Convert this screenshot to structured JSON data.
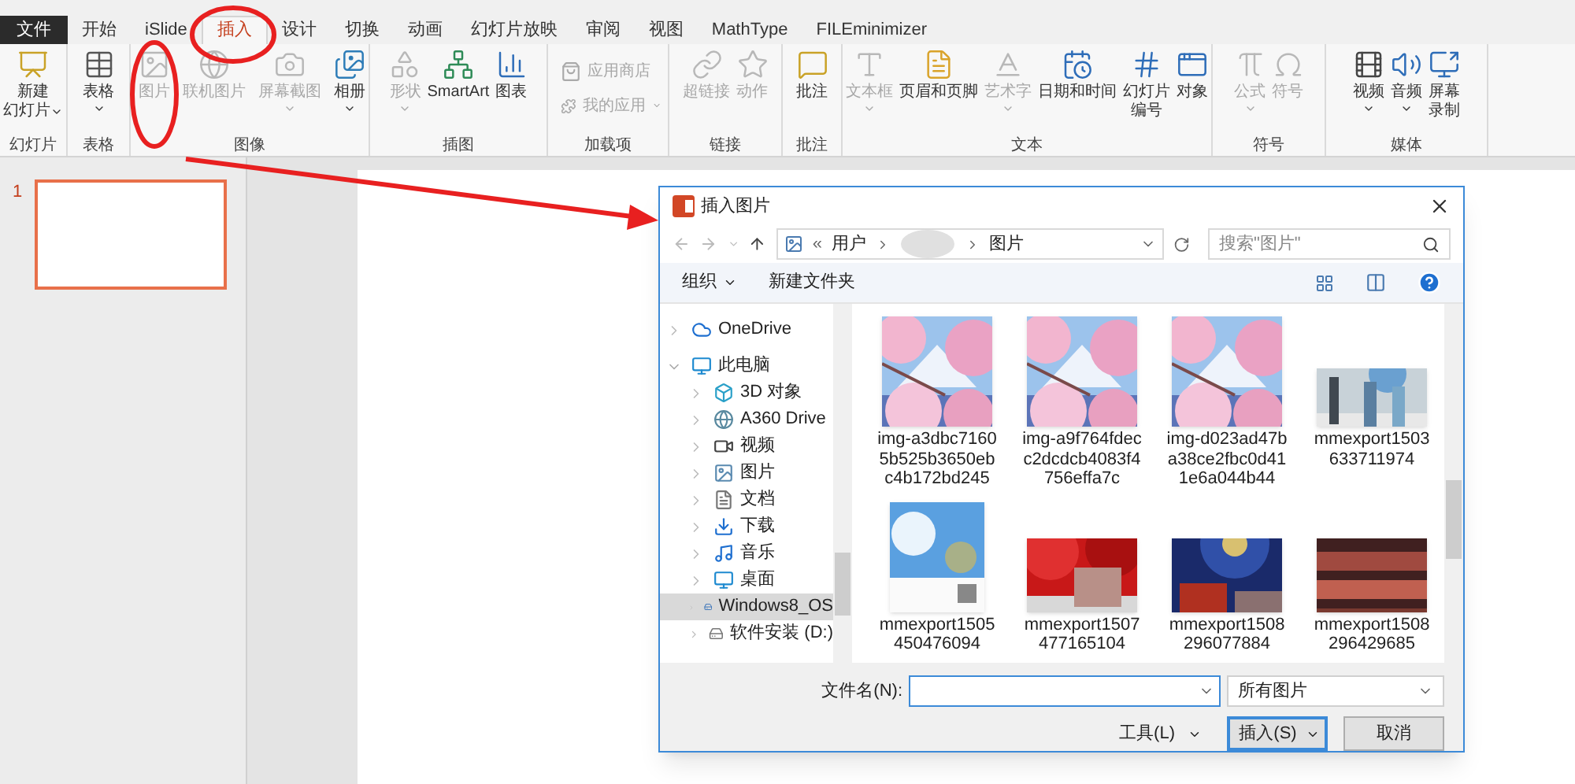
{
  "tabs": [
    {
      "label": "文件",
      "kind": "file",
      "selected": false
    },
    {
      "label": "开始",
      "kind": "tab",
      "selected": false
    },
    {
      "label": "iSlide",
      "kind": "tab",
      "selected": false
    },
    {
      "label": "插入",
      "kind": "tab",
      "selected": true
    },
    {
      "label": "设计",
      "kind": "tab",
      "selected": false
    },
    {
      "label": "切换",
      "kind": "tab",
      "selected": false
    },
    {
      "label": "动画",
      "kind": "tab",
      "selected": false
    },
    {
      "label": "幻灯片放映",
      "kind": "tab",
      "selected": false
    },
    {
      "label": "审阅",
      "kind": "tab",
      "selected": false
    },
    {
      "label": "视图",
      "kind": "tab",
      "selected": false
    },
    {
      "label": "MathType",
      "kind": "tab",
      "selected": false
    },
    {
      "label": "FILEminimizer",
      "kind": "tab",
      "selected": false
    }
  ],
  "ribbon": {
    "groups": [
      {
        "label": "幻灯片",
        "buttons": [
          {
            "lines": [
              "新建",
              "幻灯片"
            ],
            "kind": "large",
            "disabled": false,
            "dropdown": true
          }
        ]
      },
      {
        "label": "表格",
        "buttons": [
          {
            "label": "表格",
            "kind": "large",
            "disabled": false,
            "dropdown": true
          }
        ]
      },
      {
        "label": "图像",
        "buttons": [
          {
            "label": "图片",
            "kind": "large",
            "disabled": true,
            "dropdown": false
          },
          {
            "label": "联机图片",
            "kind": "large",
            "disabled": true,
            "dropdown": false
          },
          {
            "label": "屏幕截图",
            "kind": "large",
            "disabled": true,
            "dropdown": true
          },
          {
            "label": "相册",
            "kind": "large",
            "disabled": false,
            "dropdown": true
          }
        ]
      },
      {
        "label": "插图",
        "buttons": [
          {
            "label": "形状",
            "kind": "large",
            "disabled": true,
            "dropdown": true
          },
          {
            "label": "SmartArt",
            "kind": "large",
            "disabled": false,
            "dropdown": false
          },
          {
            "label": "图表",
            "kind": "large",
            "disabled": false,
            "dropdown": false
          }
        ]
      },
      {
        "label": "加载项",
        "buttons": [
          {
            "label": "应用商店",
            "kind": "small",
            "disabled": true,
            "dropdown": false
          },
          {
            "label": "我的应用",
            "kind": "small",
            "disabled": true,
            "dropdown": true
          }
        ]
      },
      {
        "label": "链接",
        "buttons": [
          {
            "label": "超链接",
            "kind": "large",
            "disabled": true,
            "dropdown": false
          },
          {
            "label": "动作",
            "kind": "large",
            "disabled": true,
            "dropdown": false
          }
        ]
      },
      {
        "label": "批注",
        "buttons": [
          {
            "label": "批注",
            "kind": "large",
            "disabled": false,
            "dropdown": false
          }
        ]
      },
      {
        "label": "文本",
        "buttons": [
          {
            "label": "文本框",
            "kind": "large",
            "disabled": true,
            "dropdown": true
          },
          {
            "label": "页眉和页脚",
            "kind": "large",
            "disabled": false,
            "dropdown": false
          },
          {
            "label": "艺术字",
            "kind": "large",
            "disabled": true,
            "dropdown": true
          },
          {
            "label": "日期和时间",
            "kind": "large",
            "disabled": false,
            "dropdown": false
          },
          {
            "lines": [
              "幻灯片",
              "编号"
            ],
            "kind": "large",
            "disabled": false,
            "dropdown": false
          },
          {
            "label": "对象",
            "kind": "large",
            "disabled": false,
            "dropdown": false
          }
        ]
      },
      {
        "label": "符号",
        "buttons": [
          {
            "label": "公式",
            "kind": "large",
            "disabled": true,
            "dropdown": true
          },
          {
            "label": "符号",
            "kind": "large",
            "disabled": true,
            "dropdown": false
          }
        ]
      },
      {
        "label": "媒体",
        "buttons": [
          {
            "label": "视频",
            "kind": "large",
            "disabled": false,
            "dropdown": true
          },
          {
            "label": "音频",
            "kind": "large",
            "disabled": false,
            "dropdown": true
          },
          {
            "lines": [
              "屏幕",
              "录制"
            ],
            "kind": "large",
            "disabled": false,
            "dropdown": false
          }
        ]
      }
    ]
  },
  "slides": [
    {
      "number": "1",
      "selected": true
    }
  ],
  "dialog": {
    "title": "插入图片",
    "address": {
      "overflow": "«",
      "segments": [
        "用户",
        "图片"
      ]
    },
    "search": {
      "placeholder": "搜索\"图片\""
    },
    "toolbar": [
      "组织",
      "新建文件夹"
    ],
    "tree": [
      {
        "label": "OneDrive",
        "expanded": false,
        "selected": false
      },
      {
        "label": "此电脑",
        "expanded": true,
        "selected": false,
        "children": [
          {
            "label": "3D 对象",
            "expanded": false,
            "selected": false
          },
          {
            "label": "A360 Drive",
            "expanded": false,
            "selected": false
          },
          {
            "label": "视频",
            "expanded": false,
            "selected": false
          },
          {
            "label": "图片",
            "expanded": false,
            "selected": false
          },
          {
            "label": "文档",
            "expanded": false,
            "selected": false
          },
          {
            "label": "下载",
            "expanded": false,
            "selected": false
          },
          {
            "label": "音乐",
            "expanded": false,
            "selected": false
          },
          {
            "label": "桌面",
            "expanded": false,
            "selected": false
          },
          {
            "label": "Windows8_OS",
            "expanded": false,
            "selected": true
          },
          {
            "label": "软件安装 (D:)",
            "expanded": false,
            "selected": false
          }
        ]
      }
    ],
    "files": [
      {
        "name": "img-a3dbc71605b525b3650ebc4b172bd245",
        "kind": "picture"
      },
      {
        "name": "img-a9f764fdecc2dcdcb4083f4756effa7c",
        "kind": "picture"
      },
      {
        "name": "img-d023ad47ba38ce2fbc0d411e6a044b44",
        "kind": "picture"
      },
      {
        "name": "mmexport1503633711974",
        "kind": "picture"
      },
      {
        "name": "mmexport1505450476094",
        "kind": "picture"
      },
      {
        "name": "mmexport1507477165104",
        "kind": "picture"
      },
      {
        "name": "mmexport1508296077884",
        "kind": "picture"
      },
      {
        "name": "mmexport1508296429685",
        "kind": "picture"
      }
    ],
    "filename": {
      "label": "文件名(N):"
    },
    "filetype": "所有图片",
    "tools": "工具(L)",
    "buttons": [
      "插入(S)",
      "取消"
    ]
  }
}
